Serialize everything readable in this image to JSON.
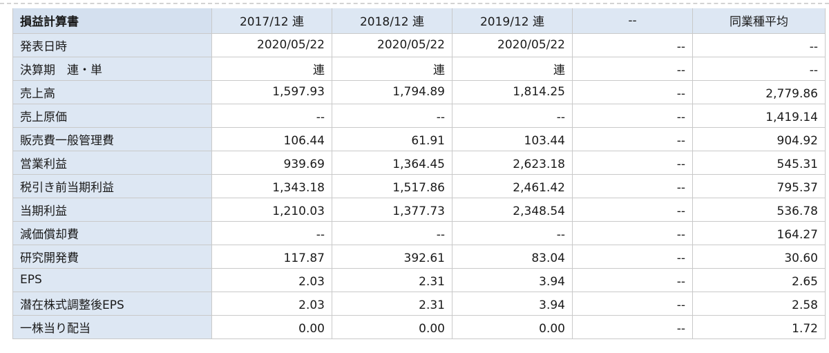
{
  "table": {
    "corner_label": "損益計算書",
    "columns": [
      "2017/12 連",
      "2018/12 連",
      "2019/12 連",
      "--",
      "同業種平均"
    ],
    "rows": [
      {
        "label": "発表日時",
        "values": [
          "2020/05/22",
          "2020/05/22",
          "2020/05/22",
          "--",
          "--"
        ]
      },
      {
        "label": "決算期　連・単",
        "values": [
          "連",
          "連",
          "連",
          "--",
          "--"
        ]
      },
      {
        "label": "売上高",
        "values": [
          "1,597.93",
          "1,794.89",
          "1,814.25",
          "--",
          "2,779.86"
        ]
      },
      {
        "label": "売上原価",
        "values": [
          "--",
          "--",
          "--",
          "--",
          "1,419.14"
        ]
      },
      {
        "label": "販売費一般管理費",
        "values": [
          "106.44",
          "61.91",
          "103.44",
          "--",
          "904.92"
        ]
      },
      {
        "label": "営業利益",
        "values": [
          "939.69",
          "1,364.45",
          "2,623.18",
          "--",
          "545.31"
        ]
      },
      {
        "label": "税引き前当期利益",
        "values": [
          "1,343.18",
          "1,517.86",
          "2,461.42",
          "--",
          "795.37"
        ]
      },
      {
        "label": "当期利益",
        "values": [
          "1,210.03",
          "1,377.73",
          "2,348.54",
          "--",
          "536.78"
        ]
      },
      {
        "label": "減価償却費",
        "values": [
          "--",
          "--",
          "--",
          "--",
          "164.27"
        ]
      },
      {
        "label": "研究開発費",
        "values": [
          "117.87",
          "392.61",
          "83.04",
          "--",
          "30.60"
        ]
      },
      {
        "label": "EPS",
        "values": [
          "2.03",
          "2.31",
          "3.94",
          "--",
          "2.65"
        ]
      },
      {
        "label": "潜在株式調整後EPS",
        "values": [
          "2.03",
          "2.31",
          "3.94",
          "--",
          "2.58"
        ]
      },
      {
        "label": "一株当り配当",
        "values": [
          "0.00",
          "0.00",
          "0.00",
          "--",
          "1.72"
        ]
      }
    ]
  }
}
